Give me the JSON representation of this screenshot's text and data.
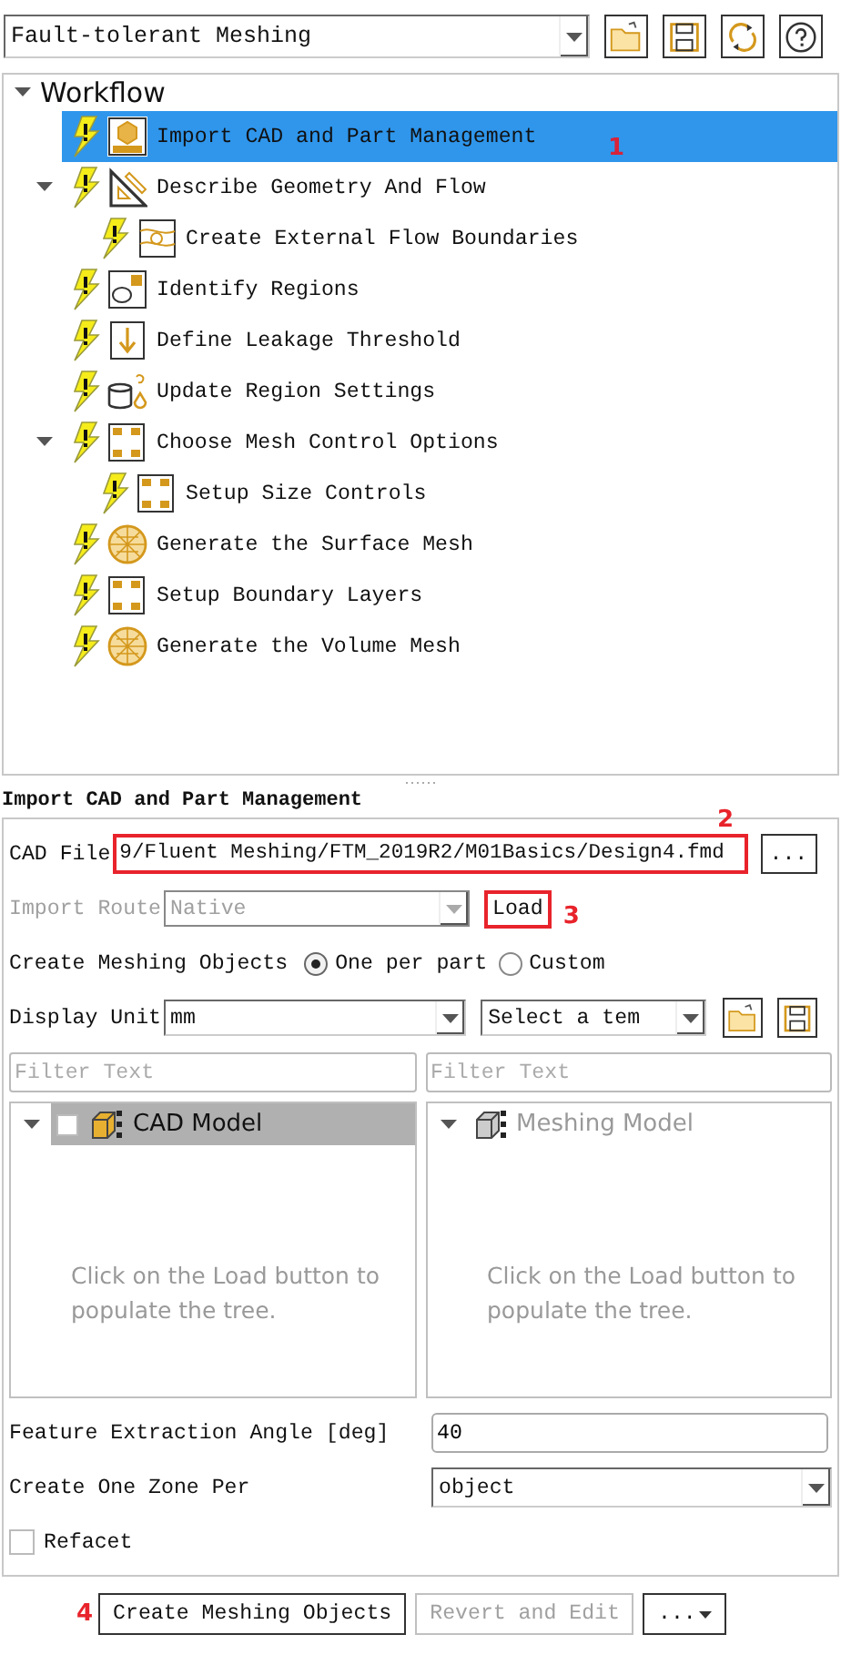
{
  "top_bar": {
    "workflow_type": "Fault-tolerant Meshing"
  },
  "workflow": {
    "title": "Workflow",
    "expanded": true,
    "tasks": [
      {
        "label": "Import CAD and Part Management",
        "kind": "import",
        "selected": true,
        "callout": "1"
      },
      {
        "label": "Describe Geometry And Flow",
        "kind": "geometry",
        "selected": false,
        "expanded": true,
        "children": [
          {
            "label": "Create External Flow Boundaries",
            "kind": "boundaries",
            "selected": false
          }
        ]
      },
      {
        "label": "Identify Regions",
        "kind": "regions",
        "selected": false
      },
      {
        "label": "Define Leakage Threshold",
        "kind": "leakage",
        "selected": false
      },
      {
        "label": "Update Region Settings",
        "kind": "update",
        "selected": false
      },
      {
        "label": "Choose Mesh Control Options",
        "kind": "controls",
        "selected": false,
        "expanded": true,
        "children": [
          {
            "label": "Setup Size Controls",
            "kind": "controls",
            "selected": false
          }
        ]
      },
      {
        "label": "Generate the Surface Mesh",
        "kind": "mesh",
        "selected": false
      },
      {
        "label": "Setup Boundary Layers",
        "kind": "controls",
        "selected": false
      },
      {
        "label": "Generate the Volume Mesh",
        "kind": "mesh",
        "selected": false
      }
    ]
  },
  "task_panel": {
    "title": "Import CAD and Part Management",
    "cad_file": {
      "label": "CAD File",
      "value": "9/Fluent Meshing/FTM_2019R2/M01Basics/Design4.fmd",
      "highlighted": true,
      "callout": "2"
    },
    "browse_button": "...",
    "import_route": {
      "label": "Import Route",
      "value": "Native",
      "disabled": true
    },
    "load_button": {
      "label": "Load",
      "highlighted": true,
      "callout": "3"
    },
    "create_meshing_objects": {
      "label": "Create Meshing Objects",
      "options": [
        {
          "label": "One per part",
          "selected": true
        },
        {
          "label": "Custom",
          "selected": false
        }
      ]
    },
    "display_unit": {
      "label": "Display Unit",
      "value": "mm"
    },
    "template": {
      "value": "Select a tem"
    },
    "trees": [
      {
        "filter_placeholder": "Filter Text",
        "root": "CAD Model",
        "selected": true,
        "disabled": false,
        "checkbox": {
          "checked": false
        },
        "empty_message": "Click on the Load button to populate the tree."
      },
      {
        "filter_placeholder": "Filter Text",
        "root": "Meshing Model",
        "selected": false,
        "disabled": true,
        "empty_message": "Click on the Load button to populate the tree."
      }
    ],
    "feature_angle": {
      "label": "Feature Extraction Angle [deg]",
      "value": "40"
    },
    "zone_per": {
      "label": "Create One Zone Per",
      "value": "object"
    },
    "refacet": {
      "label": "Refacet",
      "checked": false
    }
  },
  "buttons": [
    {
      "label": "Create Meshing Objects",
      "kind": "push",
      "disabled": false,
      "callout": "4"
    },
    {
      "label": "Revert and Edit",
      "kind": "push",
      "disabled": true
    },
    {
      "label": "...",
      "kind": "menu",
      "disabled": false
    }
  ]
}
